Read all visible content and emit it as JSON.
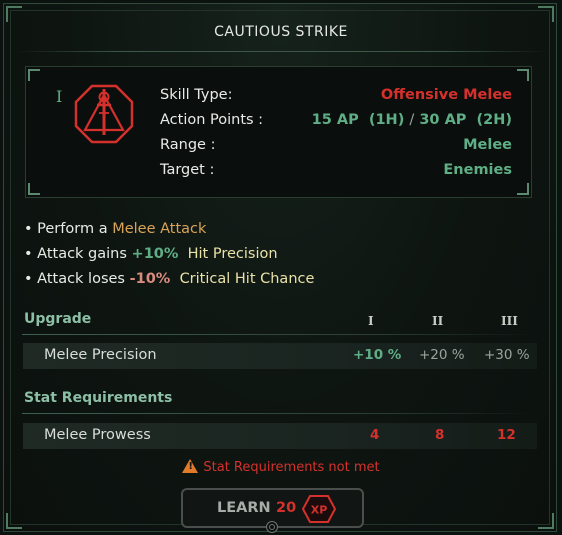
{
  "skill": {
    "title": "CAUTIOUS STRIKE",
    "rank_numeral": "I",
    "icon": "melee-strike-icon"
  },
  "stats": [
    {
      "label": "Skill Type:",
      "value": "Offensive Melee"
    },
    {
      "label": "Action Points :",
      "value_1": "15 AP  (1H)",
      "sep": "/",
      "value_2": "30 AP  (2H)"
    },
    {
      "label": "Range :",
      "value": "Melee"
    },
    {
      "label": "Target :",
      "value": "Enemies"
    }
  ],
  "effects": [
    {
      "prefix": "• Perform a ",
      "highlight": "Melee Attack"
    },
    {
      "prefix": "• Attack gains ",
      "amount": "+10%",
      "highlight": "Hit Precision"
    },
    {
      "prefix": "• Attack loses ",
      "amount": "-10%",
      "highlight": "Critical Hit Chance"
    }
  ],
  "upgrade": {
    "header": "Upgrade",
    "tiers": [
      "I",
      "II",
      "III"
    ],
    "row_label": "Melee Precision",
    "values": [
      "+10 %",
      "+20 %",
      "+30 %"
    ]
  },
  "requirements": {
    "header": "Stat Requirements",
    "row_label": "Melee Prowess",
    "values": [
      "4",
      "8",
      "12"
    ],
    "warning": "Stat Requirements not met"
  },
  "learn_button": {
    "label": "LEARN",
    "cost": "20",
    "unit": "XP"
  },
  "colors": {
    "accent_green": "#5fae86",
    "alert_red": "#d5312c",
    "gold": "#d9a35a",
    "pale_yellow": "#e9e2a8",
    "warning_orange": "#e07b2a"
  }
}
